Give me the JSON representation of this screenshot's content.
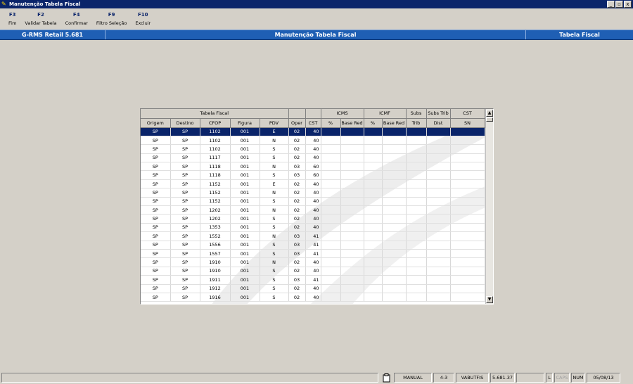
{
  "window": {
    "title": "Manutenção Tabela Fiscal",
    "controls": [
      "_",
      "▫",
      "x"
    ]
  },
  "toolbar": [
    {
      "key": "F3",
      "label": "Fim"
    },
    {
      "key": "F2",
      "label": "Validar Tabela"
    },
    {
      "key": "F4",
      "label": "Confirmar"
    },
    {
      "key": "F9",
      "label": "Filtro Seleção"
    },
    {
      "key": "F10",
      "label": "Excluir"
    }
  ],
  "header": {
    "left": "G-RMS Retail 5.681",
    "center": "Manutenção Tabela Fiscal",
    "right": "Tabela Fiscal"
  },
  "grid": {
    "group_headers": {
      "tabela_fiscal": "Tabela Fiscal",
      "icms": "ICMS",
      "icmf": "ICMF",
      "subs": "Subs",
      "subs_trib": "Subs Trib",
      "cst": "CST"
    },
    "columns": [
      "Origem",
      "Destino",
      "CFOP",
      "Figura",
      "PDV",
      "Oper",
      "CST",
      "%",
      "Base Red",
      "%",
      "Base Red",
      "Trib",
      "Dist",
      "SN"
    ],
    "selected_row": 0,
    "rows": [
      [
        "SP",
        "SP",
        "1102",
        "001",
        "E",
        "02",
        "40"
      ],
      [
        "SP",
        "SP",
        "1102",
        "001",
        "N",
        "02",
        "40"
      ],
      [
        "SP",
        "SP",
        "1102",
        "001",
        "S",
        "02",
        "40"
      ],
      [
        "SP",
        "SP",
        "1117",
        "001",
        "S",
        "02",
        "40"
      ],
      [
        "SP",
        "SP",
        "1118",
        "001",
        "N",
        "03",
        "60"
      ],
      [
        "SP",
        "SP",
        "1118",
        "001",
        "S",
        "03",
        "60"
      ],
      [
        "SP",
        "SP",
        "1152",
        "001",
        "E",
        "02",
        "40"
      ],
      [
        "SP",
        "SP",
        "1152",
        "001",
        "N",
        "02",
        "40"
      ],
      [
        "SP",
        "SP",
        "1152",
        "001",
        "S",
        "02",
        "40"
      ],
      [
        "SP",
        "SP",
        "1202",
        "001",
        "N",
        "02",
        "40"
      ],
      [
        "SP",
        "SP",
        "1202",
        "001",
        "S",
        "02",
        "40"
      ],
      [
        "SP",
        "SP",
        "1353",
        "001",
        "S",
        "02",
        "40"
      ],
      [
        "SP",
        "SP",
        "1552",
        "001",
        "N",
        "03",
        "41"
      ],
      [
        "SP",
        "SP",
        "1556",
        "001",
        "S",
        "03",
        "41"
      ],
      [
        "SP",
        "SP",
        "1557",
        "001",
        "S",
        "03",
        "41"
      ],
      [
        "SP",
        "SP",
        "1910",
        "001",
        "N",
        "02",
        "40"
      ],
      [
        "SP",
        "SP",
        "1910",
        "001",
        "S",
        "02",
        "40"
      ],
      [
        "SP",
        "SP",
        "1911",
        "001",
        "S",
        "03",
        "41"
      ],
      [
        "SP",
        "SP",
        "1912",
        "001",
        "S",
        "02",
        "40"
      ],
      [
        "SP",
        "SP",
        "1916",
        "001",
        "S",
        "02",
        "40"
      ]
    ]
  },
  "scrollbar": {
    "up": "▲",
    "down": "▼"
  },
  "statusbar": {
    "message": "",
    "icon": "clipboard-icon",
    "mode": "MANUAL",
    "code": "4-3",
    "user": "VABUTFIS",
    "version": "5.681.37",
    "blank": "",
    "l": "L",
    "caps": "CAPS",
    "num": "NUM",
    "date": "05/08/13"
  }
}
